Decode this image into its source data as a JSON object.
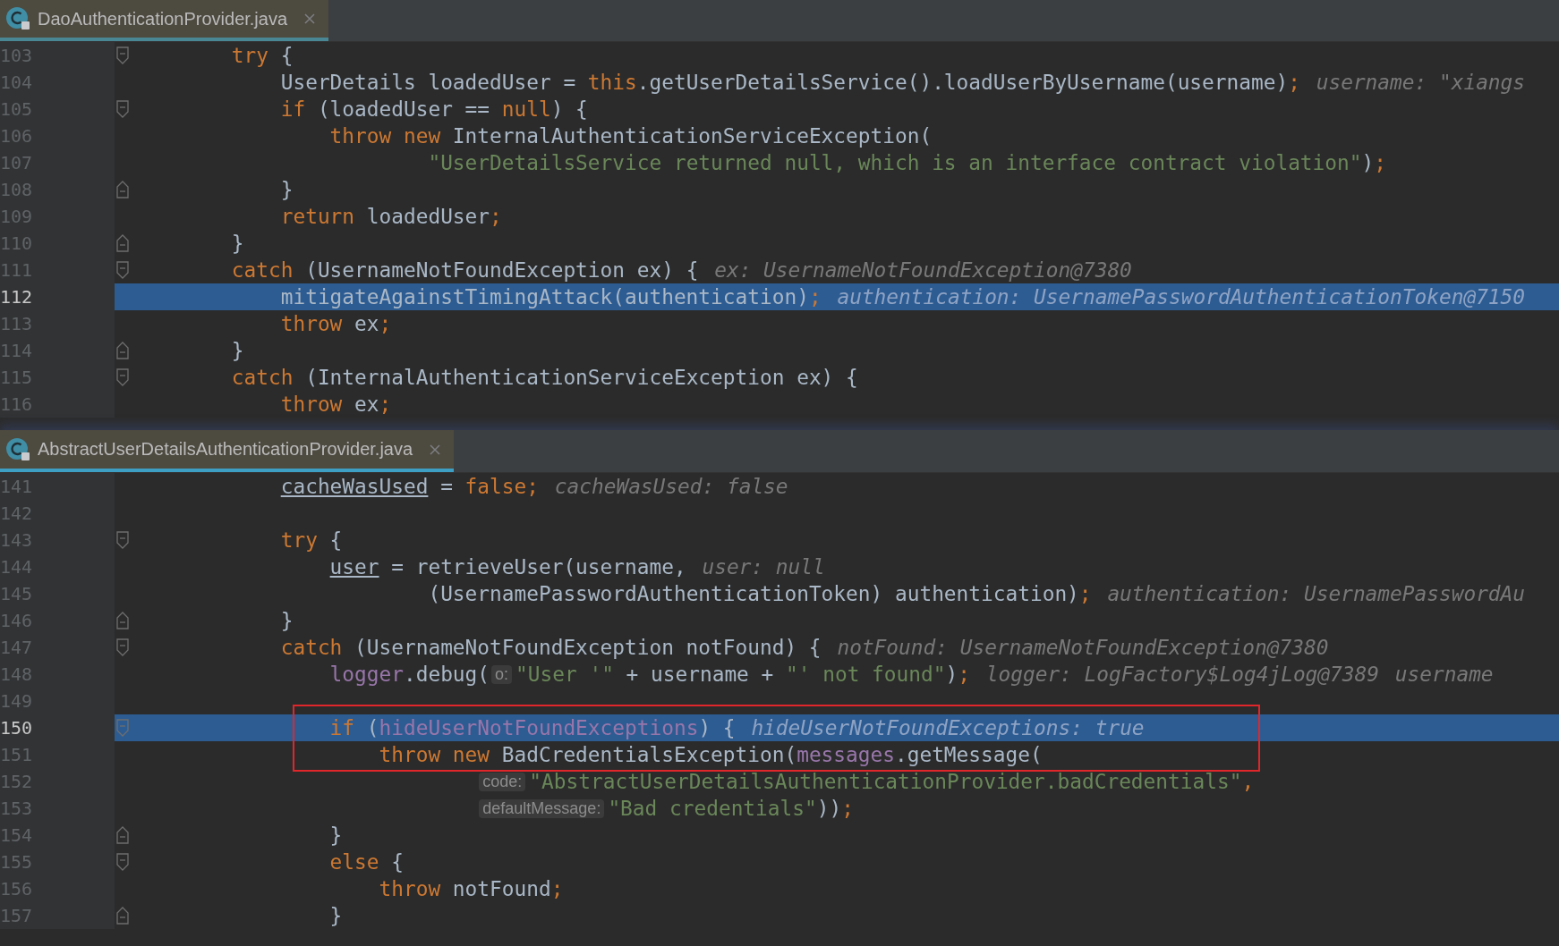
{
  "panes": [
    {
      "tab": {
        "title": "DaoAuthenticationProvider.java"
      },
      "focused": false,
      "lines": [
        {
          "number": "103",
          "fold_start": true,
          "fold_end": false,
          "current": false,
          "boxed": false,
          "segments": [
            {
              "kind": "code",
              "tokens": [
                {
                  "kind": "keyword",
                  "text": "        try"
                },
                {
                  "kind": "plain",
                  "text": " {"
                }
              ]
            }
          ]
        },
        {
          "number": "104",
          "fold_start": false,
          "fold_end": false,
          "current": false,
          "boxed": false,
          "segments": [
            {
              "kind": "code",
              "tokens": [
                {
                  "kind": "plain",
                  "text": "            UserDetails loadedUser = "
                },
                {
                  "kind": "keyword",
                  "text": "this"
                },
                {
                  "kind": "plain",
                  "text": ".getUserDetailsService().loadUserByUsername(username)"
                },
                {
                  "kind": "keyword",
                  "text": ";"
                }
              ]
            },
            {
              "kind": "hint",
              "text": "username: \"xiangs"
            }
          ]
        },
        {
          "number": "105",
          "fold_start": true,
          "fold_end": false,
          "current": false,
          "boxed": false,
          "segments": [
            {
              "kind": "code",
              "tokens": [
                {
                  "kind": "keyword",
                  "text": "            if"
                },
                {
                  "kind": "plain",
                  "text": " (loadedUser == "
                },
                {
                  "kind": "keyword",
                  "text": "null"
                },
                {
                  "kind": "plain",
                  "text": ") {"
                }
              ]
            }
          ]
        },
        {
          "number": "106",
          "fold_start": false,
          "fold_end": false,
          "current": false,
          "boxed": false,
          "segments": [
            {
              "kind": "code",
              "tokens": [
                {
                  "kind": "keyword",
                  "text": "                throw new"
                },
                {
                  "kind": "plain",
                  "text": " InternalAuthenticationServiceException("
                }
              ]
            }
          ]
        },
        {
          "number": "107",
          "fold_start": false,
          "fold_end": false,
          "current": false,
          "boxed": false,
          "segments": [
            {
              "kind": "code",
              "tokens": [
                {
                  "kind": "string",
                  "text": "                        \"UserDetailsService returned null, which is an interface contract violation\""
                },
                {
                  "kind": "plain",
                  "text": ")"
                },
                {
                  "kind": "keyword",
                  "text": ";"
                }
              ]
            }
          ]
        },
        {
          "number": "108",
          "fold_start": false,
          "fold_end": true,
          "current": false,
          "boxed": false,
          "segments": [
            {
              "kind": "code",
              "tokens": [
                {
                  "kind": "plain",
                  "text": "            }"
                }
              ]
            }
          ]
        },
        {
          "number": "109",
          "fold_start": false,
          "fold_end": false,
          "current": false,
          "boxed": false,
          "segments": [
            {
              "kind": "code",
              "tokens": [
                {
                  "kind": "keyword",
                  "text": "            return"
                },
                {
                  "kind": "plain",
                  "text": " loadedUser"
                },
                {
                  "kind": "keyword",
                  "text": ";"
                }
              ]
            }
          ]
        },
        {
          "number": "110",
          "fold_start": false,
          "fold_end": true,
          "current": false,
          "boxed": false,
          "segments": [
            {
              "kind": "code",
              "tokens": [
                {
                  "kind": "plain",
                  "text": "        }"
                }
              ]
            }
          ]
        },
        {
          "number": "111",
          "fold_start": true,
          "fold_end": false,
          "current": false,
          "boxed": false,
          "segments": [
            {
              "kind": "code",
              "tokens": [
                {
                  "kind": "keyword",
                  "text": "        catch"
                },
                {
                  "kind": "plain",
                  "text": " (UsernameNotFoundException ex) {"
                }
              ]
            },
            {
              "kind": "hint",
              "text": "ex: UsernameNotFoundException@7380"
            }
          ]
        },
        {
          "number": "112",
          "fold_start": false,
          "fold_end": false,
          "current": true,
          "boxed": false,
          "segments": [
            {
              "kind": "code",
              "tokens": [
                {
                  "kind": "plain",
                  "text": "            mitigateAgainstTimingAttack(authentication)"
                },
                {
                  "kind": "keyword",
                  "text": ";"
                }
              ]
            },
            {
              "kind": "hint",
              "text": "authentication: UsernamePasswordAuthenticationToken@7150"
            }
          ]
        },
        {
          "number": "113",
          "fold_start": false,
          "fold_end": false,
          "current": false,
          "boxed": false,
          "segments": [
            {
              "kind": "code",
              "tokens": [
                {
                  "kind": "keyword",
                  "text": "            throw"
                },
                {
                  "kind": "plain",
                  "text": " ex"
                },
                {
                  "kind": "keyword",
                  "text": ";"
                }
              ]
            }
          ]
        },
        {
          "number": "114",
          "fold_start": false,
          "fold_end": true,
          "current": false,
          "boxed": false,
          "segments": [
            {
              "kind": "code",
              "tokens": [
                {
                  "kind": "plain",
                  "text": "        }"
                }
              ]
            }
          ]
        },
        {
          "number": "115",
          "fold_start": true,
          "fold_end": false,
          "current": false,
          "boxed": false,
          "segments": [
            {
              "kind": "code",
              "tokens": [
                {
                  "kind": "keyword",
                  "text": "        catch"
                },
                {
                  "kind": "plain",
                  "text": " (InternalAuthenticationServiceException ex) {"
                }
              ]
            }
          ]
        },
        {
          "number": "116",
          "fold_start": false,
          "fold_end": false,
          "current": false,
          "boxed": false,
          "segments": [
            {
              "kind": "code",
              "tokens": [
                {
                  "kind": "keyword",
                  "text": "            throw"
                },
                {
                  "kind": "plain",
                  "text": " ex"
                },
                {
                  "kind": "keyword",
                  "text": ";"
                }
              ]
            }
          ]
        }
      ]
    },
    {
      "tab": {
        "title": "AbstractUserDetailsAuthenticationProvider.java"
      },
      "focused": true,
      "lines": [
        {
          "number": "141",
          "fold_start": false,
          "fold_end": false,
          "current": false,
          "boxed": false,
          "segments": [
            {
              "kind": "code",
              "tokens": [
                {
                  "kind": "underlined",
                  "text": "            cacheWasUsed"
                },
                {
                  "kind": "plain",
                  "text": " = "
                },
                {
                  "kind": "keyword",
                  "text": "false;"
                }
              ]
            },
            {
              "kind": "hint",
              "text": "cacheWasUsed: false"
            }
          ]
        },
        {
          "number": "142",
          "fold_start": false,
          "fold_end": false,
          "current": false,
          "boxed": false
        },
        {
          "number": "143",
          "fold_start": true,
          "fold_end": false,
          "current": false,
          "boxed": false,
          "segments": [
            {
              "kind": "code",
              "tokens": [
                {
                  "kind": "keyword",
                  "text": "            try"
                },
                {
                  "kind": "plain",
                  "text": " {"
                }
              ]
            }
          ]
        },
        {
          "number": "144",
          "fold_start": false,
          "fold_end": false,
          "current": false,
          "boxed": false,
          "segments": [
            {
              "kind": "code",
              "tokens": [
                {
                  "kind": "underlined",
                  "text": "                user"
                },
                {
                  "kind": "plain",
                  "text": " = retrieveUser(username,"
                }
              ]
            },
            {
              "kind": "hint",
              "text": "user: null"
            }
          ]
        },
        {
          "number": "145",
          "fold_start": false,
          "fold_end": false,
          "current": false,
          "boxed": false,
          "segments": [
            {
              "kind": "code",
              "tokens": [
                {
                  "kind": "plain",
                  "text": "                        (UsernamePasswordAuthenticationToken) authentication)"
                },
                {
                  "kind": "keyword",
                  "text": ";"
                }
              ]
            },
            {
              "kind": "hint",
              "text": "authentication: UsernamePasswordAu"
            }
          ]
        },
        {
          "number": "146",
          "fold_start": false,
          "fold_end": true,
          "current": false,
          "boxed": false,
          "segments": [
            {
              "kind": "code",
              "tokens": [
                {
                  "kind": "plain",
                  "text": "            }"
                }
              ]
            }
          ]
        },
        {
          "number": "147",
          "fold_start": true,
          "fold_end": false,
          "current": false,
          "boxed": false,
          "segments": [
            {
              "kind": "code",
              "tokens": [
                {
                  "kind": "keyword",
                  "text": "            catch"
                },
                {
                  "kind": "plain",
                  "text": " (UsernameNotFoundException notFound) {"
                }
              ]
            },
            {
              "kind": "hint",
              "text": "notFound: UsernameNotFoundException@7380"
            }
          ]
        },
        {
          "number": "148",
          "fold_start": false,
          "fold_end": false,
          "current": false,
          "boxed": false,
          "segments": [
            {
              "kind": "code",
              "tokens": [
                {
                  "kind": "field",
                  "text": "                logger"
                },
                {
                  "kind": "plain",
                  "text": ".debug("
                }
              ]
            },
            {
              "kind": "inlay",
              "text": "o:"
            },
            {
              "kind": "code",
              "tokens": [
                {
                  "kind": "string",
                  "text": "\"User '\""
                },
                {
                  "kind": "plain",
                  "text": " + username + "
                },
                {
                  "kind": "string",
                  "text": "\"' not found\""
                },
                {
                  "kind": "plain",
                  "text": ")"
                },
                {
                  "kind": "keyword",
                  "text": ";"
                }
              ]
            },
            {
              "kind": "hint",
              "text": "logger: LogFactory$Log4jLog@7389"
            },
            {
              "kind": "hint",
              "text": "username"
            }
          ]
        },
        {
          "number": "149",
          "fold_start": false,
          "fold_end": false,
          "current": false,
          "boxed": false
        },
        {
          "number": "150",
          "fold_start": true,
          "fold_end": false,
          "current": true,
          "boxed": true,
          "segments": [
            {
              "kind": "code",
              "tokens": [
                {
                  "kind": "keyword",
                  "text": "                if"
                },
                {
                  "kind": "plain",
                  "text": " ("
                },
                {
                  "kind": "field",
                  "text": "hideUserNotFoundExceptions"
                },
                {
                  "kind": "plain",
                  "text": ") {"
                }
              ]
            },
            {
              "kind": "hint",
              "text": "hideUserNotFoundExceptions: true"
            }
          ]
        },
        {
          "number": "151",
          "fold_start": false,
          "fold_end": false,
          "current": false,
          "boxed": true,
          "segments": [
            {
              "kind": "code",
              "tokens": [
                {
                  "kind": "keyword",
                  "text": "                    throw new"
                },
                {
                  "kind": "plain",
                  "text": " BadCredentialsException("
                },
                {
                  "kind": "field",
                  "text": "messages"
                },
                {
                  "kind": "plain",
                  "text": ".getMessage("
                }
              ]
            }
          ]
        },
        {
          "number": "152",
          "fold_start": false,
          "fold_end": false,
          "current": false,
          "boxed": false,
          "segments": [
            {
              "kind": "inlay",
              "text": "                            code:"
            },
            {
              "kind": "code",
              "tokens": [
                {
                  "kind": "string",
                  "text": "\"AbstractUserDetailsAuthenticationProvider.badCredentials\""
                },
                {
                  "kind": "keyword",
                  "text": ","
                }
              ]
            }
          ]
        },
        {
          "number": "153",
          "fold_start": false,
          "fold_end": false,
          "current": false,
          "boxed": false,
          "segments": [
            {
              "kind": "inlay",
              "text": "                            defaultMessage:"
            },
            {
              "kind": "code",
              "tokens": [
                {
                  "kind": "string",
                  "text": "\"Bad credentials\""
                },
                {
                  "kind": "plain",
                  "text": "))"
                },
                {
                  "kind": "keyword",
                  "text": ";"
                }
              ]
            }
          ]
        },
        {
          "number": "154",
          "fold_start": false,
          "fold_end": true,
          "current": false,
          "boxed": false,
          "segments": [
            {
              "kind": "code",
              "tokens": [
                {
                  "kind": "plain",
                  "text": "                }"
                }
              ]
            }
          ]
        },
        {
          "number": "155",
          "fold_start": true,
          "fold_end": false,
          "current": false,
          "boxed": false,
          "segments": [
            {
              "kind": "code",
              "tokens": [
                {
                  "kind": "keyword",
                  "text": "                else"
                },
                {
                  "kind": "plain",
                  "text": " {"
                }
              ]
            }
          ]
        },
        {
          "number": "156",
          "fold_start": false,
          "fold_end": false,
          "current": false,
          "boxed": false,
          "segments": [
            {
              "kind": "code",
              "tokens": [
                {
                  "kind": "keyword",
                  "text": "                    throw"
                },
                {
                  "kind": "plain",
                  "text": " notFound"
                },
                {
                  "kind": "keyword",
                  "text": ";"
                }
              ]
            }
          ]
        },
        {
          "number": "157",
          "fold_start": false,
          "fold_end": true,
          "current": false,
          "boxed": false,
          "segments": [
            {
              "kind": "code",
              "tokens": [
                {
                  "kind": "plain",
                  "text": "                }"
                }
              ]
            }
          ]
        }
      ]
    }
  ]
}
